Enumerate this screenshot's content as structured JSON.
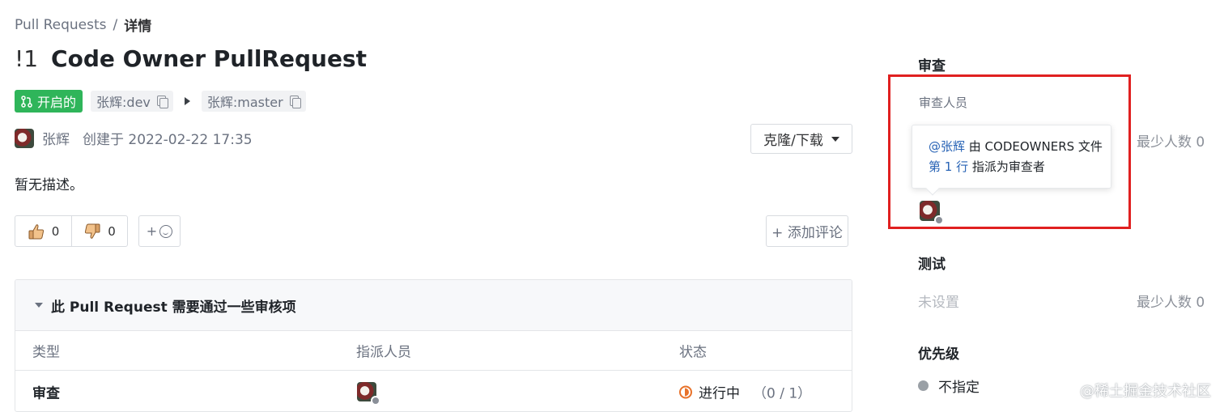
{
  "breadcrumb": {
    "root": "Pull Requests",
    "separator": "/",
    "current": "详情"
  },
  "pr": {
    "number": "!1",
    "title": "Code Owner PullRequest",
    "status": "开启的",
    "source_branch": "张辉:dev",
    "target_branch": "张辉:master",
    "author": "张辉",
    "created": "创建于 2022-02-22 17:35",
    "description": "暂无描述。"
  },
  "actions": {
    "clone_download": "克隆/下载",
    "add_comment": "+ 添加评论",
    "emoji_plus": "+"
  },
  "reactions": {
    "thumbs_up": "0",
    "thumbs_down": "0"
  },
  "checks": {
    "heading": "此 Pull Request 需要通过一些审核项",
    "columns": [
      "类型",
      "指派人员",
      "状态"
    ],
    "rows": [
      {
        "type": "审查",
        "status": "进行中",
        "progress": "（0 / 1）"
      }
    ]
  },
  "sidebar": {
    "review": {
      "title": "审查",
      "reviewers_label": "审查人员",
      "min_count": "最少人数 0",
      "tooltip": {
        "mention": "@张辉",
        "text1": " 由 CODEOWNERS 文件",
        "line_link": "第 1 行",
        "text2": " 指派为审查者"
      }
    },
    "test": {
      "title": "测试",
      "value": "未设置",
      "min_count": "最少人数 0"
    },
    "priority": {
      "title": "优先级",
      "value": "不指定"
    }
  },
  "watermark": "@稀土掘金技术社区",
  "colors": {
    "open_green": "#2fb55a",
    "highlight_red": "#e02020",
    "link_blue": "#2863b5",
    "progress_orange": "#e8722a"
  },
  "icons": [
    "pull-request-icon",
    "copy-icon",
    "arrow-right-icon",
    "caret-down-icon",
    "thumbs-up-icon",
    "thumbs-down-icon",
    "smile-icon",
    "progress-icon",
    "avatar"
  ]
}
